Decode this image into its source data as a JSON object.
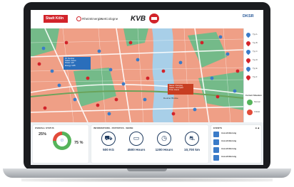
{
  "header": {
    "logo_stadt": "Stadt Köln",
    "logo_rhein": "RheinEnergie",
    "logo_netz": "NetCologne",
    "logo_kvb": "KVB",
    "logo_desr": "DKSR",
    "logo_desr_sub": ""
  },
  "map": {
    "callout_blue_lines": [
      "ID: Number",
      "Status: Active",
      "Power: kW",
      "Energy: kWh"
    ],
    "callout_red_lines": [
      "Name: Charging",
      "Status: Occupied",
      "Time: Hours"
    ],
    "road_label": "Deutzer Brücke"
  },
  "legend": {
    "items": [
      {
        "label": "Typ A",
        "color": "#3a7bc8"
      },
      {
        "label": "Typ B",
        "color": "#d2232a"
      },
      {
        "label": "Typ C",
        "color": "#3a7bc8"
      },
      {
        "label": "Typ D",
        "color": "#d2232a"
      },
      {
        "label": "Typ E",
        "color": "#3a7bc8"
      },
      {
        "label": "Typ F",
        "color": "#d2232a"
      }
    ],
    "status_title": "Current Situation",
    "status": [
      {
        "label": "Normal",
        "color": "#56b45b"
      },
      {
        "label": "Critical",
        "color": "#e24b3a"
      }
    ]
  },
  "overall": {
    "title": "OVERALL STATUS",
    "left_pct": "25%",
    "left_sub": "",
    "right_pct": "75 %",
    "right_sub": "",
    "donut_green_color": "#56b45b",
    "donut_red_color": "#e24b3a",
    "legend_text": ""
  },
  "info": {
    "title": "INFORMATIONS - STATISTICS - SENSE",
    "metrics": [
      {
        "icon": "truck-icon",
        "glyph": "⛟",
        "value": "500 KG",
        "label": ""
      },
      {
        "icon": "battery-icon",
        "glyph": "▭",
        "value": "4500 Hours",
        "label": ""
      },
      {
        "icon": "clock-icon",
        "glyph": "◷",
        "value": "1200 Hours",
        "label": ""
      },
      {
        "icon": "car-icon",
        "glyph": "⛐",
        "value": "10,700 km",
        "label": ""
      }
    ]
  },
  "events": {
    "title": "EVENTS",
    "dots": "■ ◀",
    "items": [
      {
        "title": "Ausschilderung",
        "sub": ""
      },
      {
        "title": "Ausschilderung",
        "sub": ""
      },
      {
        "title": "Ausschilderung",
        "sub": ""
      },
      {
        "title": "Ausschilderung",
        "sub": ""
      }
    ]
  }
}
